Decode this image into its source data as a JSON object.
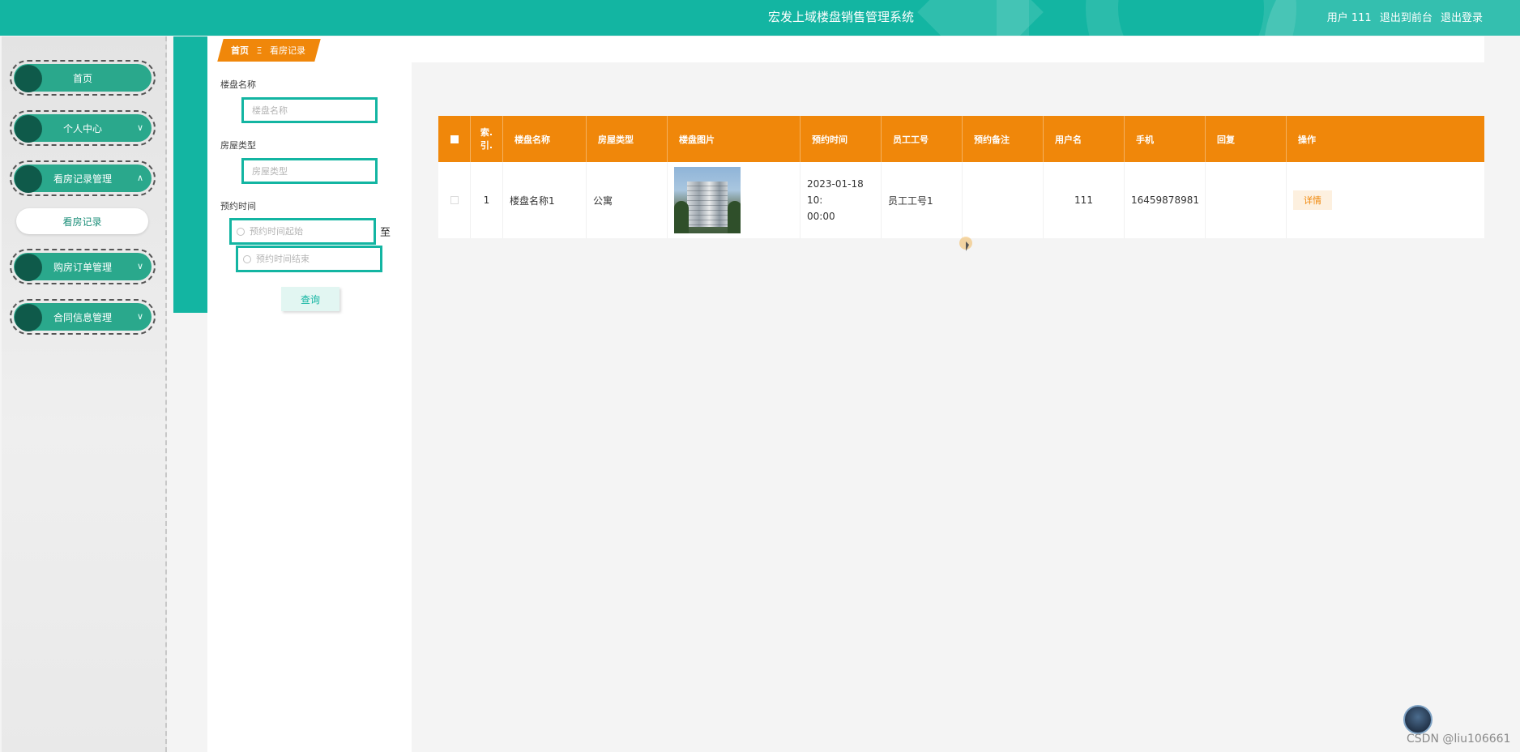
{
  "header": {
    "title": "宏发上域楼盘销售管理系统",
    "user_label": "用户 111",
    "to_front": "退出到前台",
    "logout": "退出登录"
  },
  "sidebar": {
    "items": [
      {
        "label": "首页"
      },
      {
        "label": "个人中心"
      },
      {
        "label": "看房记录管理"
      },
      {
        "label": "购房订单管理"
      },
      {
        "label": "合同信息管理"
      }
    ],
    "submenu": "看房记录"
  },
  "breadcrumb": {
    "home": "首页",
    "separator": "Ξ",
    "current": "看房记录"
  },
  "search": {
    "name_label": "楼盘名称",
    "name_placeholder": "楼盘名称",
    "type_label": "房屋类型",
    "type_placeholder": "房屋类型",
    "time_label": "预约时间",
    "start_placeholder": "预约时间起始",
    "to_text": "至",
    "end_placeholder": "预约时间结束",
    "button": "查询"
  },
  "table": {
    "columns": [
      "索引",
      "楼盘名称",
      "房屋类型",
      "楼盘图片",
      "预约时间",
      "员工工号",
      "预约备注",
      "用户名",
      "手机",
      "回复",
      "操作"
    ],
    "index_header_lines": [
      "索.",
      "引."
    ],
    "rows": [
      {
        "index": "1",
        "name": "楼盘名称1",
        "type": "公寓",
        "time": "2023-01-18 10:00:00",
        "time_line1": "2023-01-18 10:",
        "time_line2": "00:00",
        "staff": "员工工号1",
        "remark": "",
        "username": "111",
        "phone": "16459878981",
        "reply": "",
        "action": "详情"
      }
    ]
  },
  "watermark": "CSDN @liu106661",
  "colors": {
    "teal": "#13b5a2",
    "orange": "#f0870a",
    "menu_green": "#2aa88c"
  }
}
